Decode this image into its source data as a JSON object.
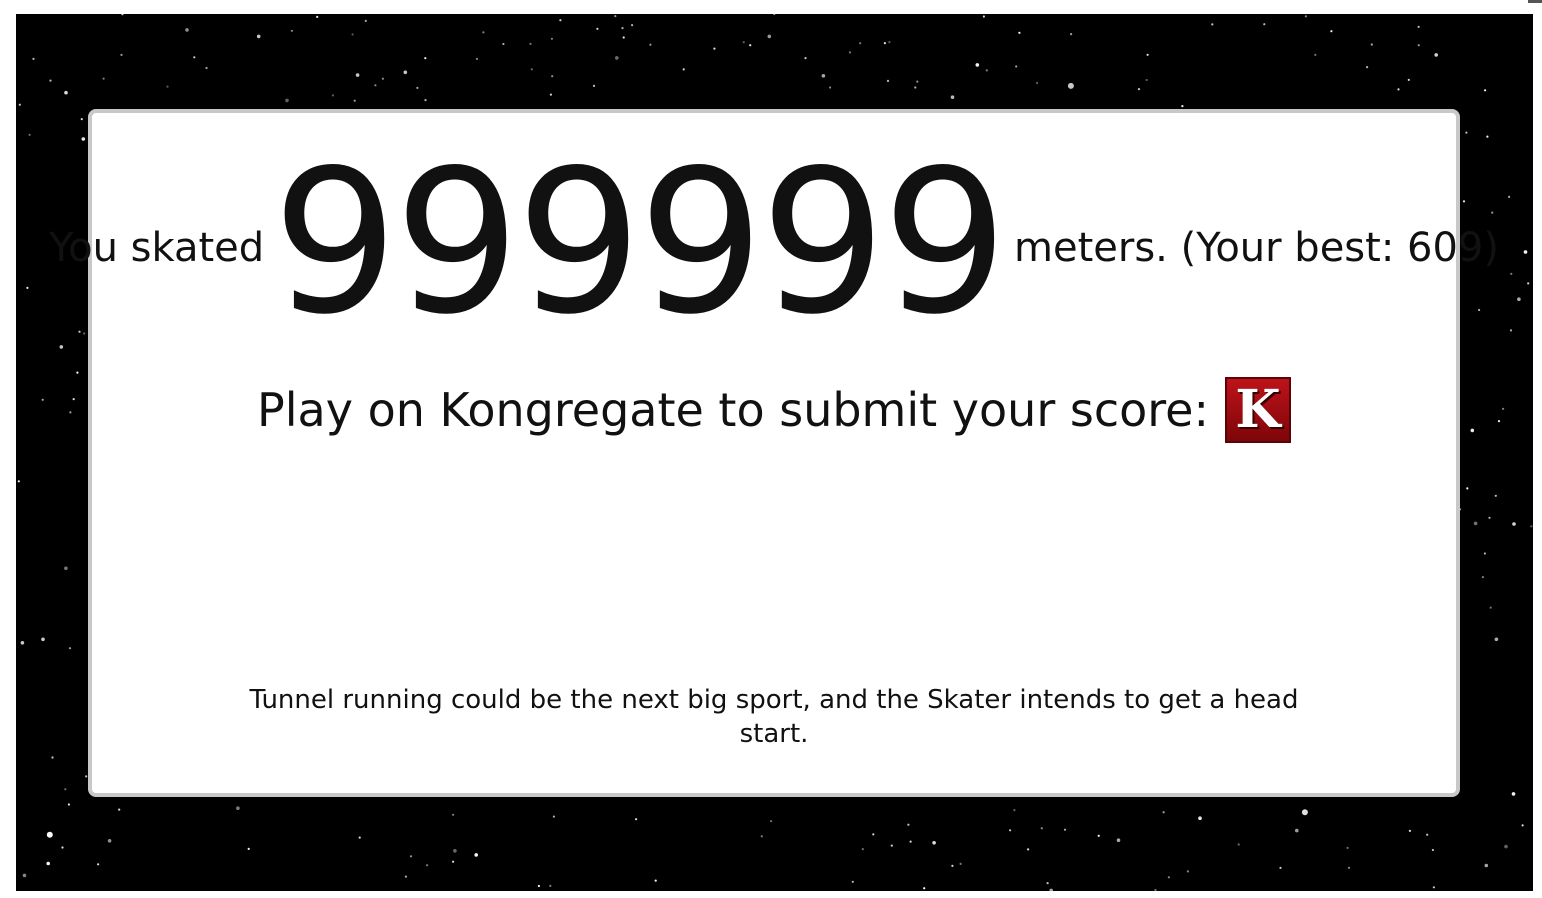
{
  "result": {
    "prefix": "You skated",
    "distance": "999999",
    "suffix": "meters. (Your best: 609)"
  },
  "kongregate": {
    "prompt": "Play on Kongregate to submit your score:",
    "badge_letter": "K",
    "badge_color": "#a00d14"
  },
  "tagline": "Tunnel running could be the next big sport, and the Skater intends to get a head start.",
  "colors": {
    "background": "#000000",
    "panel": "#ffffff",
    "panel_border": "#c8c8c8",
    "text": "#111111"
  }
}
